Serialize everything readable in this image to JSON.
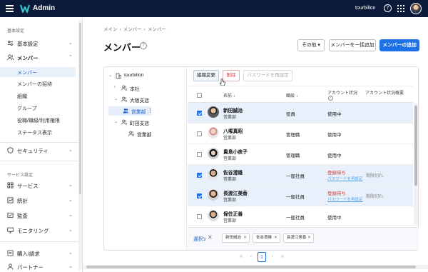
{
  "topbar": {
    "app_title": "Admin",
    "tenant": "tourbillon",
    "help_glyph": "?"
  },
  "sidebar": {
    "section_basic": "基本設定",
    "section_service": "サービス設定",
    "items": [
      {
        "label": "基本設定",
        "icon": "sliders-icon",
        "chevron": "⌄"
      },
      {
        "label": "メンバー",
        "icon": "users-icon",
        "chevron": "⌃"
      },
      {
        "label": "セキュリティ",
        "icon": "shield-icon",
        "chevron": "⌄"
      },
      {
        "label": "サービス",
        "icon": "grid-icon",
        "chevron": "⌄"
      },
      {
        "label": "統計",
        "icon": "chart-icon",
        "chevron": "⌄"
      },
      {
        "label": "監査",
        "icon": "audit-icon",
        "chevron": "⌄"
      },
      {
        "label": "モニタリング",
        "icon": "monitor-icon",
        "chevron": "⌄"
      },
      {
        "label": "購入/請求",
        "icon": "cart-icon",
        "chevron": "⌄"
      },
      {
        "label": "パートナー",
        "icon": "partner-icon",
        "chevron": "⌄"
      }
    ],
    "sub_items": [
      "メンバー",
      "メンバーの招待",
      "組織",
      "グループ",
      "役職/職級/利用権限",
      "ステータス表示"
    ]
  },
  "breadcrumb": [
    "メイン",
    "›",
    "メンバー",
    "›",
    "メンバー"
  ],
  "page": {
    "title": "メンバー",
    "help_glyph": "?",
    "btn_other": "その他 ▾",
    "btn_bulk": "メンバーを一括追加",
    "btn_add": "メンバーの追加"
  },
  "tree": {
    "root": "tourbillon",
    "nodes": [
      "本社",
      "大阪支店",
      "営業部",
      "町田支店",
      "営業部"
    ],
    "more_glyph": "⋮"
  },
  "actions": {
    "change_org": "組織変更",
    "delete": "削除",
    "reset_password": "パスワードを再設定"
  },
  "table": {
    "headers": {
      "name": "名前 ↓",
      "position": "職級 ↓",
      "account_status": "アカウント状況",
      "status_overview": "アカウント状況概要"
    },
    "help_glyph": "?",
    "rows": [
      {
        "name": "新田誠治",
        "dept": "営業部",
        "role": "役員",
        "status": "使用中",
        "status_link": "",
        "overview": "",
        "checked": true
      },
      {
        "name": "八塚真昭",
        "dept": "営業部",
        "role": "管理職",
        "status": "使用中",
        "status_link": "",
        "overview": "",
        "checked": false
      },
      {
        "name": "貴島小夜子",
        "dept": "営業部",
        "role": "管理職",
        "status": "使用中",
        "status_link": "",
        "overview": "",
        "checked": false
      },
      {
        "name": "佐谷澄雄",
        "dept": "営業部",
        "role": "一般社員",
        "status": "登録待ち",
        "status_link": "パスワードを再設定",
        "overview": "期限切れ",
        "checked": true
      },
      {
        "name": "長渡江美香",
        "dept": "営業部",
        "role": "一般社員",
        "status": "登録待ち",
        "status_link": "パスワードを再設定",
        "overview": "期限切れ",
        "checked": true
      },
      {
        "name": "保住正善",
        "dept": "営業部",
        "role": "一般社員",
        "status": "使用中",
        "status_link": "",
        "overview": "",
        "checked": false
      }
    ]
  },
  "selection": {
    "label": "選択3",
    "clear_glyph": "✕",
    "chips": [
      "新田誠治",
      "佐谷澄雄",
      "長渡江美香"
    ],
    "chip_close": "✕"
  },
  "pagination": {
    "first": "«",
    "prev": "‹",
    "current": "1",
    "next": "›",
    "last": "»"
  },
  "colors": {
    "topbar": "#0b1a3a",
    "accent": "#1d72e8",
    "selected_row": "#e7f0fb",
    "warning": "#d93a3a",
    "link": "#5aa6e8"
  }
}
